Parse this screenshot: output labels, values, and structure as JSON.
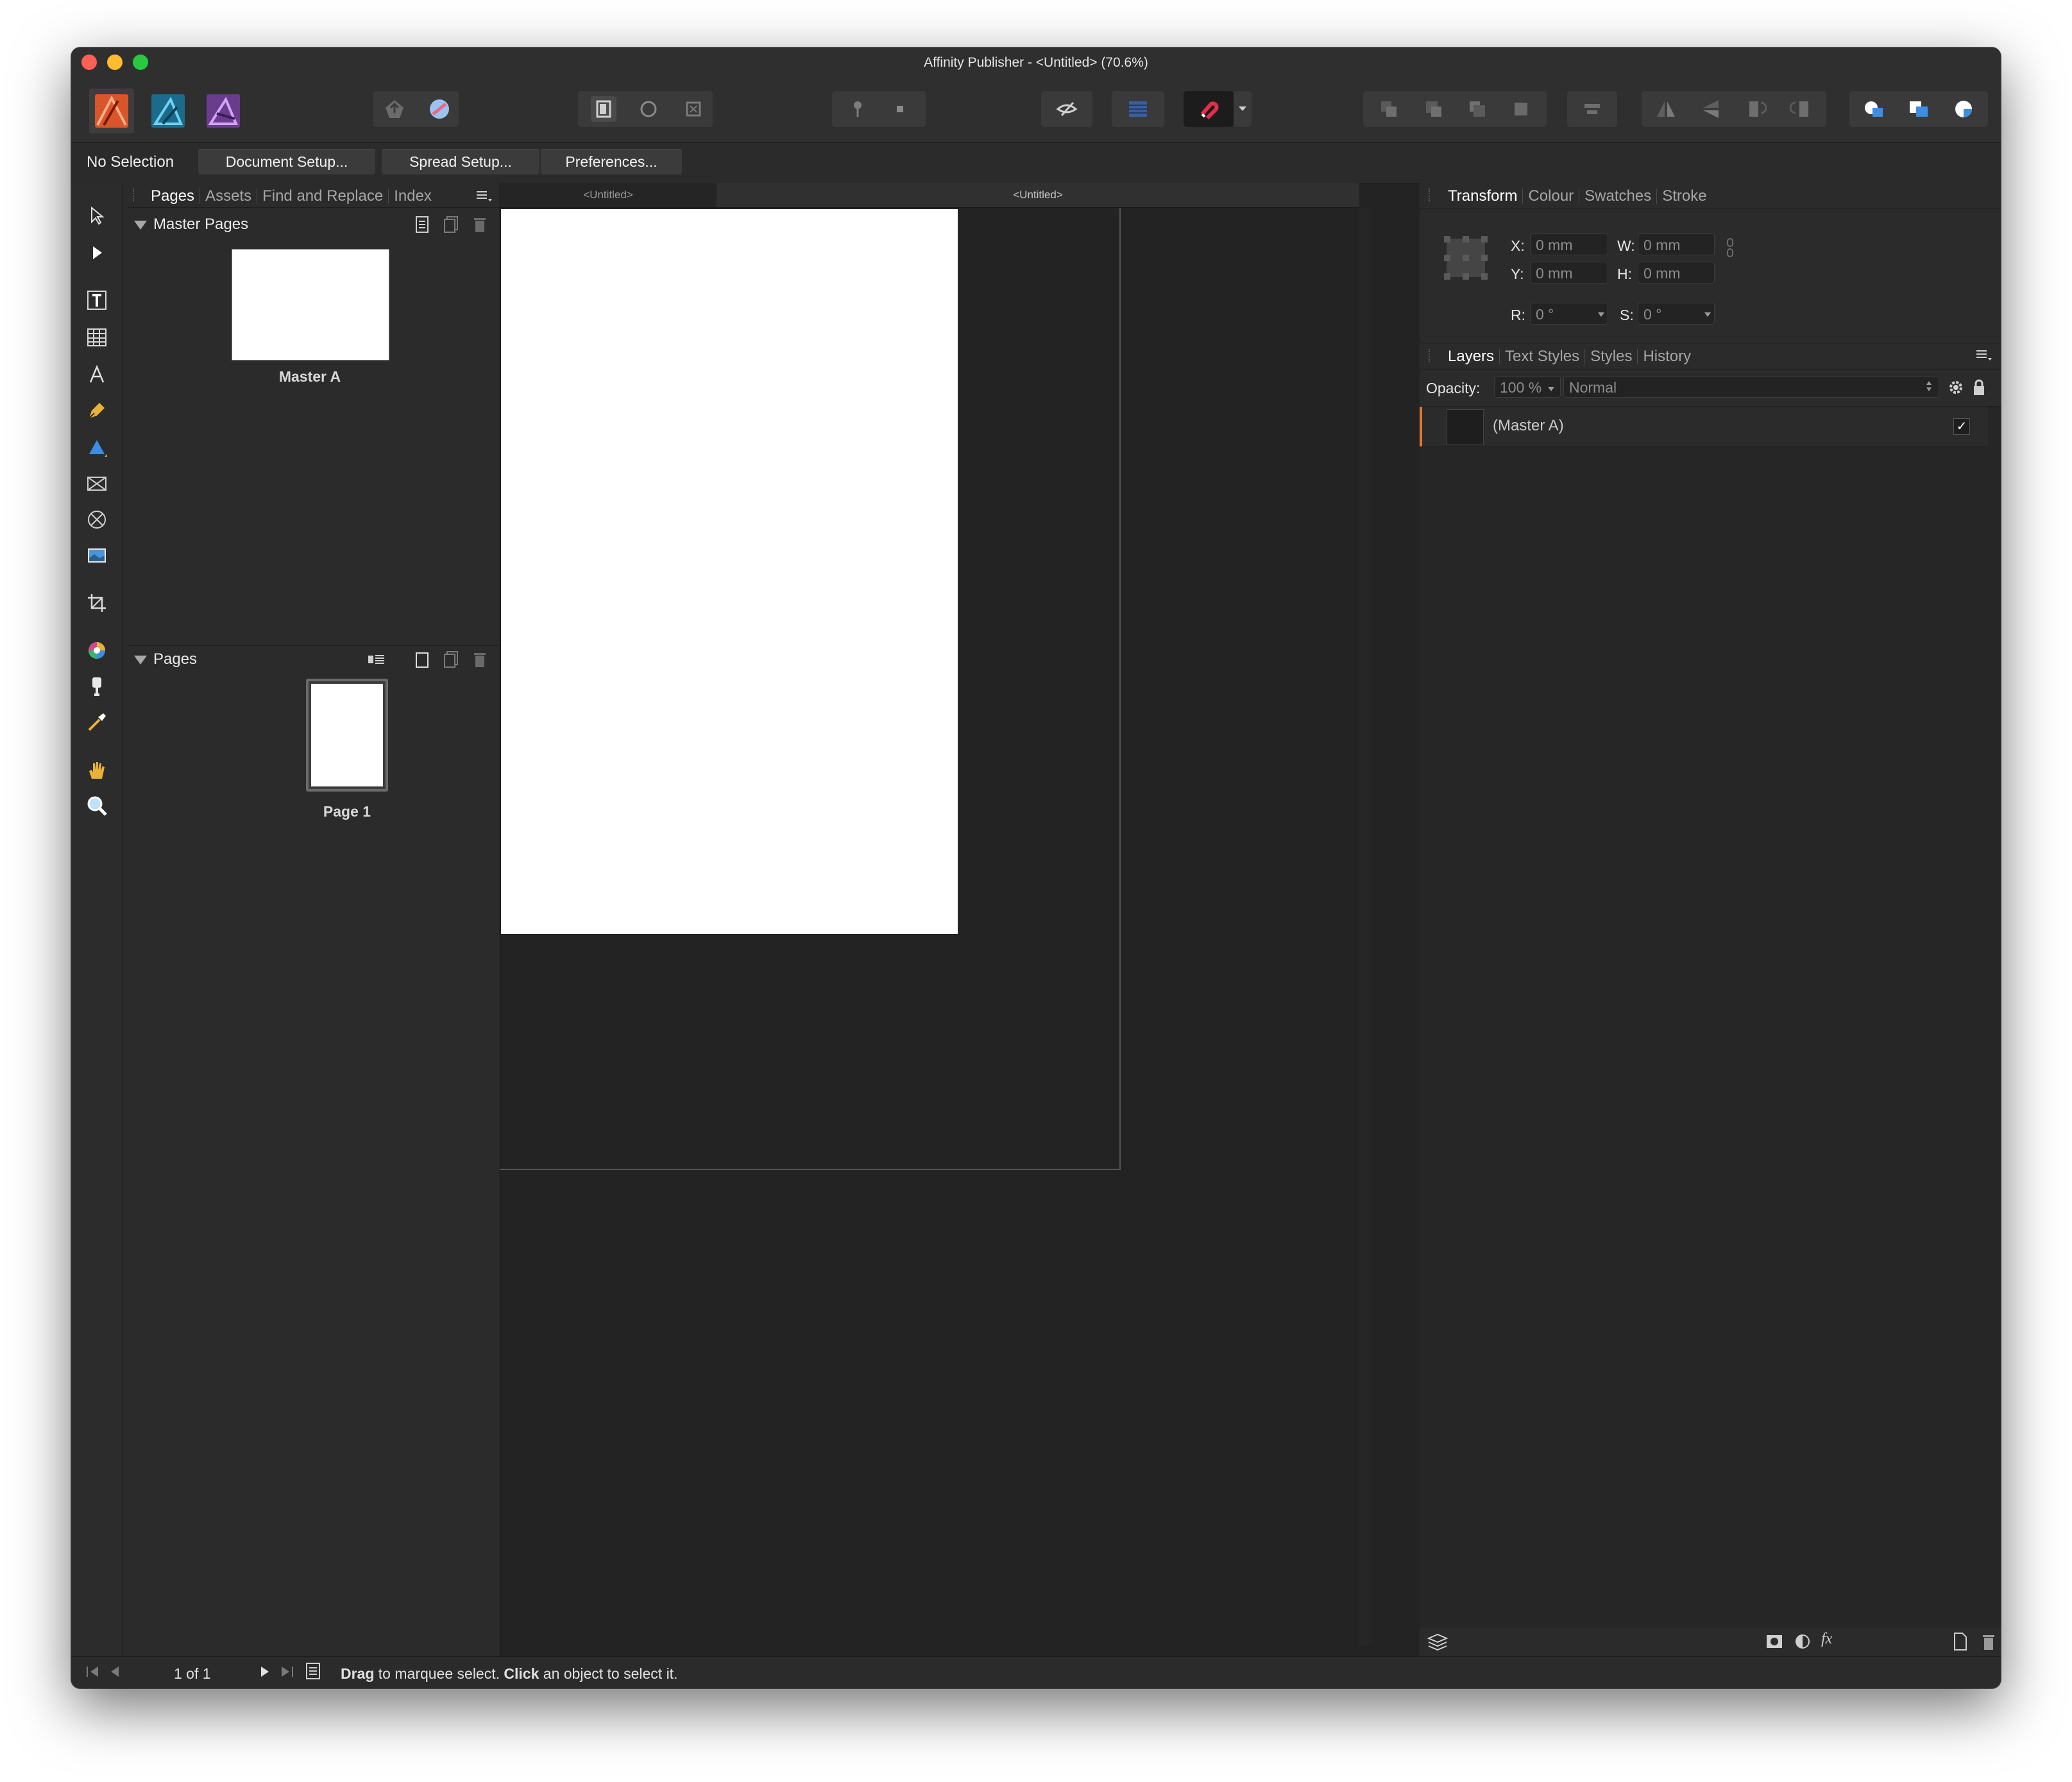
{
  "window": {
    "title": "Affinity Publisher - <Untitled> (70.6%)",
    "colors": {
      "close": "#fe5f57",
      "minimize": "#febc2e",
      "zoom": "#28c840",
      "accent": "#e2772b"
    }
  },
  "toolbar": {
    "personas": [
      "publisher-persona-icon",
      "designer-persona-icon",
      "photo-persona-icon"
    ],
    "icons": [
      "publish-icon",
      "share-icon",
      "view-mode-icon",
      "circle-mode-icon",
      "clip-mode-icon",
      "pin-icon",
      "square-icon",
      "preview-icon",
      "baseline-grid-icon",
      "snapping-magnet-icon",
      "snapping-dropdown-icon",
      "arrange-back-icon",
      "arrange-backward-icon",
      "arrange-forward-icon",
      "arrange-front-icon",
      "align-icon",
      "flip-horizontal-icon",
      "flip-vertical-icon",
      "rotate-left-icon",
      "rotate-right-icon",
      "add-boolean-icon",
      "subtract-boolean-icon",
      "intersect-boolean-icon"
    ]
  },
  "context": {
    "selection": "No Selection",
    "buttons": [
      "Document Setup...",
      "Spread Setup...",
      "Preferences..."
    ]
  },
  "tools": [
    "move-tool-icon",
    "node-tool-icon",
    "frame-text-tool-icon",
    "table-tool-icon",
    "artistic-text-tool-icon",
    "pen-tool-icon",
    "shape-tool-icon",
    "picture-frame-tool-icon",
    "ellipse-frame-tool-icon",
    "place-image-tool-icon",
    "crop-tool-icon",
    "colour-picker-tool-icon",
    "fill-tool-icon",
    "eyedropper-tool-icon",
    "hand-tool-icon",
    "zoom-tool-icon"
  ],
  "left_panel": {
    "tabs": [
      "Pages",
      "Assets",
      "Find and Replace",
      "Index"
    ],
    "master_section": "Master Pages",
    "master_label": "Master A",
    "pages_section": "Pages",
    "page_label": "Page 1"
  },
  "canvas": {
    "tabs": [
      "<Untitled>",
      "<Untitled>"
    ]
  },
  "transform": {
    "tabs": [
      "Transform",
      "Colour",
      "Swatches",
      "Stroke"
    ],
    "x_label": "X:",
    "x_value": "0 mm",
    "y_label": "Y:",
    "y_value": "0 mm",
    "w_label": "W:",
    "w_value": "0 mm",
    "h_label": "H:",
    "h_value": "0 mm",
    "r_label": "R:",
    "r_value": "0 °",
    "s_label": "S:",
    "s_value": "0 °"
  },
  "layers": {
    "tabs": [
      "Layers",
      "Text Styles",
      "Styles",
      "History"
    ],
    "opacity_label": "Opacity:",
    "opacity_value": "100 %",
    "blend_mode": "Normal",
    "items": [
      {
        "name": "(Master A)",
        "visible_check": "✓"
      }
    ]
  },
  "status": {
    "page_indicator": "1 of 1",
    "hint_bold1": "Drag",
    "hint_text1": " to marquee select. ",
    "hint_bold2": "Click",
    "hint_text2": " an object to select it."
  }
}
